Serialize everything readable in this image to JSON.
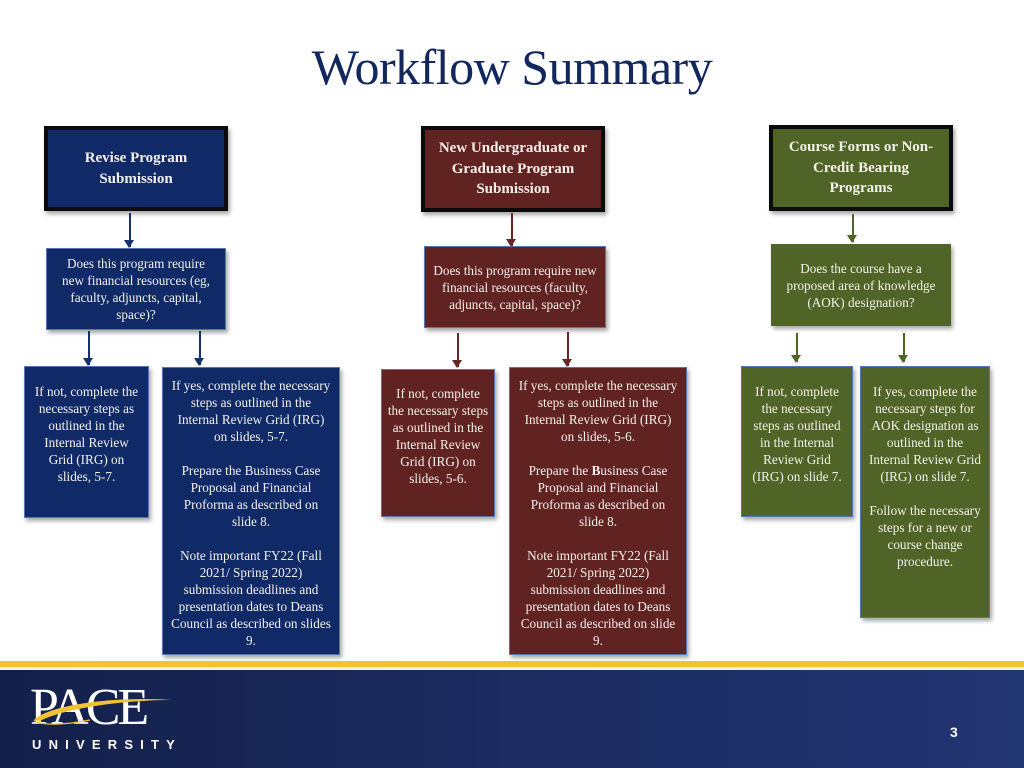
{
  "slide": {
    "title": "Workflow Summary",
    "page_number": "3"
  },
  "colors": {
    "blue": "#102a68",
    "red": "#612222",
    "green": "#4f6426",
    "title": "#12275e",
    "gold": "#f1c232"
  },
  "columns": {
    "revise": {
      "header": "Revise Program Submission",
      "question": "Does this program require new financial resources (eg, faculty, adjuncts, capital, space)?",
      "no_branch": {
        "text": "If not, complete the necessary steps as outlined in the Internal Review Grid (IRG) on slides, 5-7."
      },
      "yes_branch": {
        "p1": "If yes, complete the necessary steps as outlined in the Internal Review Grid (IRG) on slides, 5-7.",
        "p2": "Prepare the Business Case Proposal and Financial Proforma as described on slide 8.",
        "p3": "Note important FY22 (Fall 2021/ Spring 2022) submission deadlines and presentation dates to Deans Council as described on slides 9."
      }
    },
    "new_program": {
      "header": "New Undergraduate or Graduate Program Submission",
      "question": "Does this program require new financial resources (faculty, adjuncts, capital, space)?",
      "no_branch": {
        "text": "If not, complete the necessary steps as outlined in the Internal Review Grid (IRG) on slides, 5-6."
      },
      "yes_branch": {
        "p1": "If yes, complete the necessary steps as outlined in the Internal Review Grid (IRG) on slides, 5-6.",
        "p2_prefix": "Prepare the ",
        "p2_bold": "B",
        "p2_suffix": "usiness Case Proposal and Financial Proforma as described on slide 8.",
        "p3": "Note important FY22 (Fall 2021/ Spring 2022) submission deadlines and presentation dates to Deans Council as described on slide 9."
      }
    },
    "course_forms": {
      "header": "Course Forms or Non-Credit Bearing Programs",
      "question": "Does the course have a proposed area of knowledge (AOK) designation?",
      "no_branch": {
        "text": "If not, complete the necessary steps as outlined in the Internal Review Grid (IRG) on slide 7."
      },
      "yes_branch": {
        "p1": "If yes, complete the necessary steps for AOK designation as outlined in the Internal Review Grid (IRG) on slide 7.",
        "p2": "Follow the necessary steps for a new or course change procedure."
      }
    }
  },
  "footer": {
    "logo_wordmark": "PACE",
    "logo_subtitle": "UNIVERSITY"
  }
}
